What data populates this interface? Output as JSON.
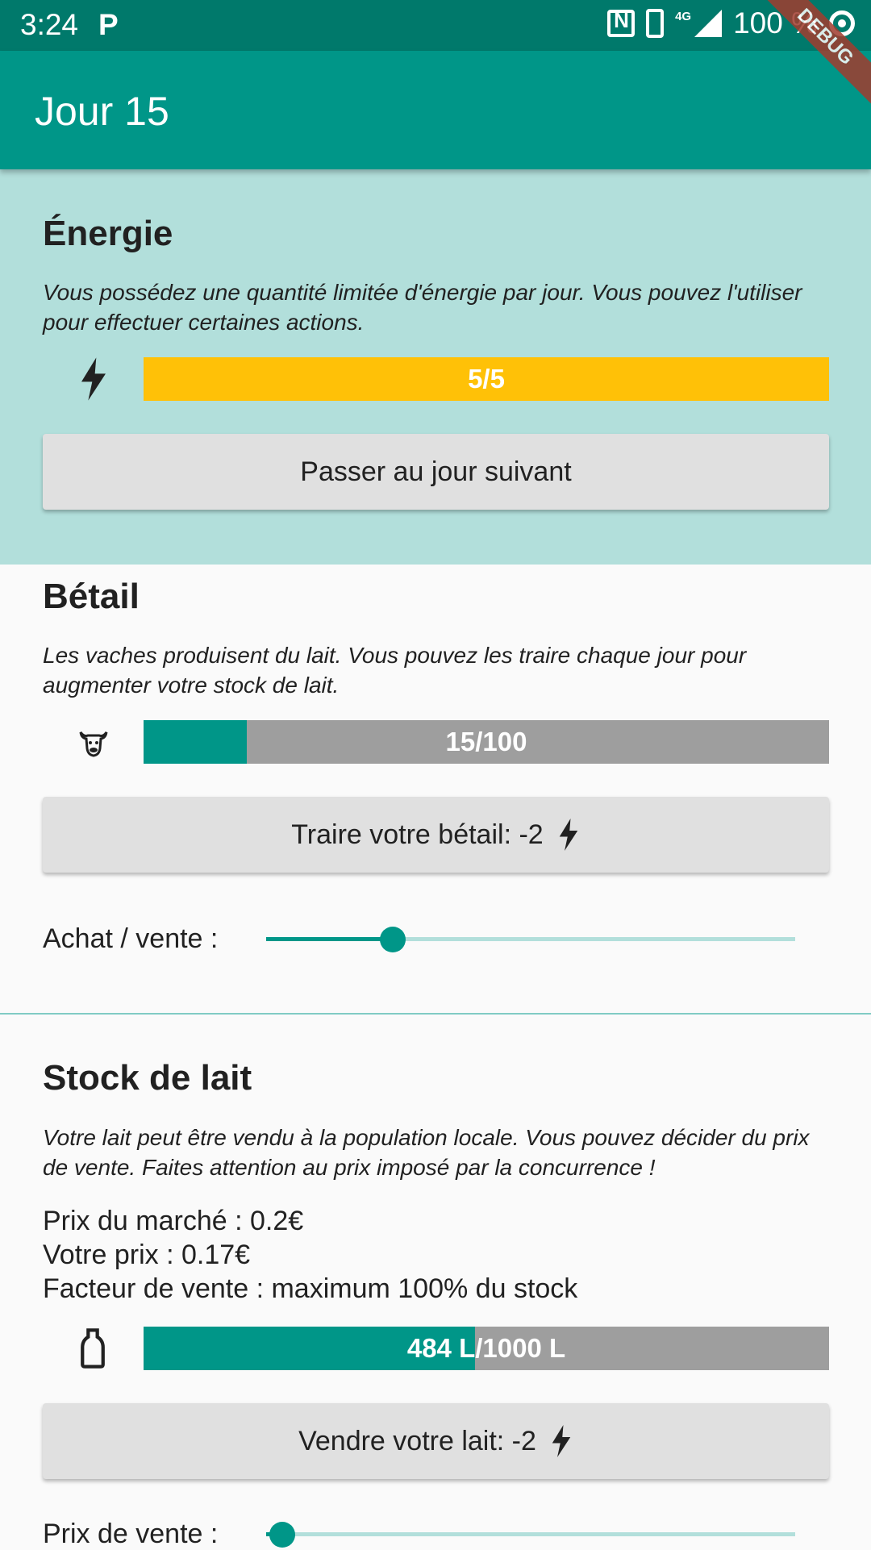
{
  "status_bar": {
    "time": "3:24",
    "app_icon": "P",
    "network_label": "4G",
    "battery": "100 %",
    "icons": [
      "nfc-icon",
      "vibrate-icon",
      "signal-icon",
      "target-icon"
    ]
  },
  "debug_banner": "DEBUG",
  "app_bar": {
    "title": "Jour 15"
  },
  "energy": {
    "title": "Énergie",
    "description": "Vous possédez une quantité limitée d'énergie par jour. Vous pouvez l'utiliser pour effectuer certaines actions.",
    "bar_text": "5/5",
    "bar_fraction": 1.0,
    "bar_color": "#ffc107",
    "next_day_button": "Passer au jour suivant",
    "icon": "bolt-icon"
  },
  "livestock": {
    "title": "Bétail",
    "description": "Les vaches produisent du lait. Vous pouvez les traire chaque jour pour augmenter votre stock de lait.",
    "bar_text": "15/100",
    "bar_fraction": 0.15,
    "bar_color": "#009688",
    "milk_button": "Traire votre bétail: -2",
    "slider_label": "Achat / vente :",
    "slider_value": 0.24,
    "icon": "cow-icon"
  },
  "milk_stock": {
    "title": "Stock de lait",
    "description": "Votre lait peut être vendu à la population locale. Vous pouvez décider du prix de vente. Faites attention au prix imposé par la concurrence !",
    "market_price": "Prix du marché : 0.2€",
    "your_price": "Votre prix : 0.17€",
    "sale_factor": "Facteur de vente : maximum 100% du stock",
    "bar_text": "484 L/1000 L",
    "bar_fraction": 0.484,
    "bar_color": "#009688",
    "sell_button": "Vendre votre lait: -2",
    "slider_label": "Prix de vente :",
    "slider_value": 0.03,
    "icon": "bottle-icon"
  },
  "colors": {
    "primary": "#009688",
    "primary_dark": "#00796b",
    "energy_bg": "#b2dfdb",
    "energy_bar": "#ffc107",
    "bar_track": "#9e9e9e"
  }
}
